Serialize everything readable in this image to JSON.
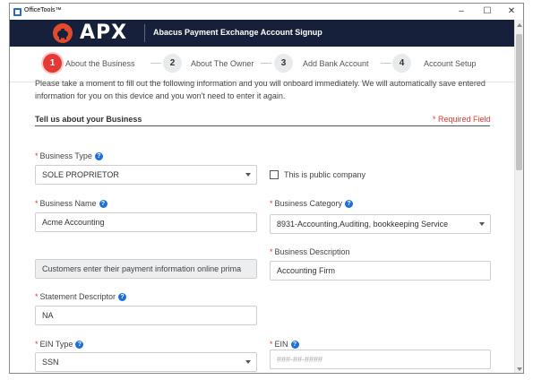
{
  "window": {
    "title": "OfficeTools™",
    "controls": {
      "minimize": "–",
      "maximize": "☐",
      "close": "✕"
    }
  },
  "header": {
    "brand": "APX",
    "title": "Abacus Payment Exchange Account Signup",
    "brand_color": "#e14b2c",
    "background_color": "#17203a"
  },
  "steps": [
    {
      "number": "1",
      "label": "About the Business",
      "active": true
    },
    {
      "number": "2",
      "label": "About The Owner",
      "active": false
    },
    {
      "number": "3",
      "label": "Add Bank Account",
      "active": false
    },
    {
      "number": "4",
      "label": "Account Setup",
      "active": false
    }
  ],
  "intro": "Please take a moment to fill out the following information and you will onboard immediately. We will automatically save entered information for you on this device and you won't need to enter it again.",
  "section": {
    "title": "Tell us about your Business",
    "required_note": "* Required Field"
  },
  "fields": {
    "business_type": {
      "label": "Business Type",
      "value": "SOLE PROPRIETOR"
    },
    "public_company": {
      "label": "This is public company",
      "checked": false
    },
    "business_name": {
      "label": "Business Name",
      "value": "Acme Accounting"
    },
    "business_category": {
      "label": "Business Category",
      "value": "8931-Accounting,Auditing, bookkeeping Service"
    },
    "payment_info": {
      "value": "Customers enter their payment information online prima"
    },
    "business_description": {
      "label": "Business Description",
      "value": "Accounting Firm"
    },
    "statement_descriptor": {
      "label": "Statement Descriptor",
      "value": "NA"
    },
    "ein_type": {
      "label": "EIN Type",
      "value": "SSN"
    },
    "ein": {
      "label": "EIN",
      "placeholder": "###-##-####"
    }
  },
  "icons": {
    "help": "?",
    "required": "*"
  },
  "colors": {
    "accent_red": "#e53935",
    "help_blue": "#1e6fd9"
  }
}
